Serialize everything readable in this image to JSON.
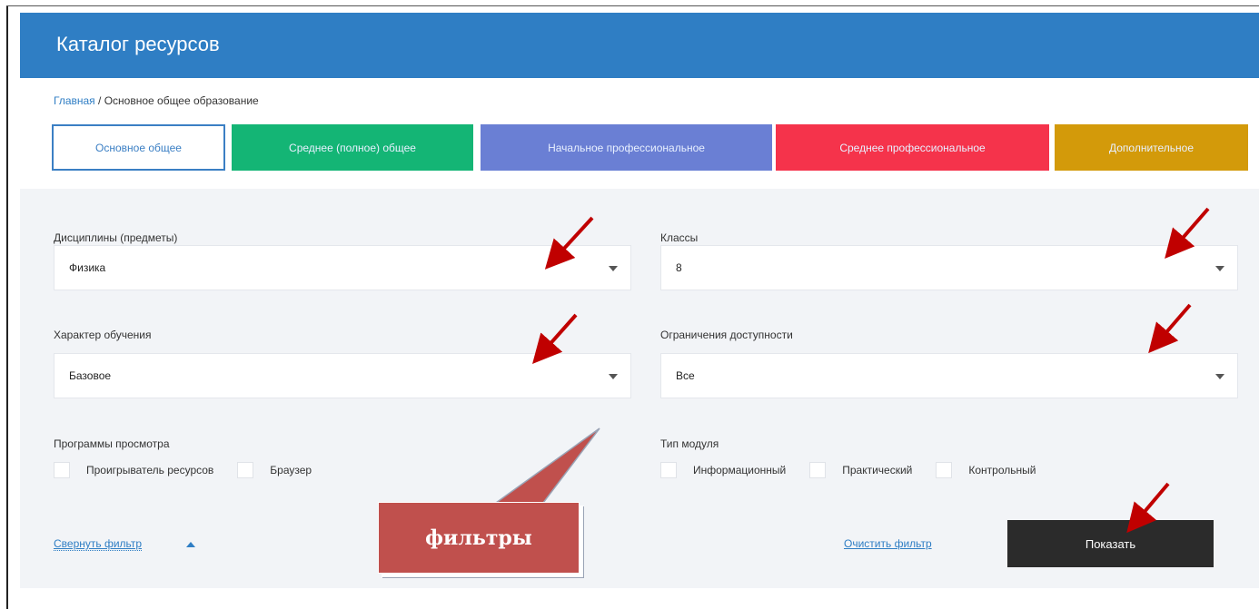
{
  "header": {
    "title": "Каталог ресурсов"
  },
  "breadcrumb": {
    "home": "Главная",
    "separator": " / ",
    "current": "Основное общее образование"
  },
  "levels": [
    {
      "label": "Основное общее",
      "active": true
    },
    {
      "label": "Среднее (полное) общее",
      "color": "#14b575"
    },
    {
      "label": "Начальное профессиональное",
      "color": "#6a7fd4"
    },
    {
      "label": "Среднее профессиональное",
      "color": "#f5334b"
    },
    {
      "label": "Дополнительное",
      "color": "#d39a0a"
    }
  ],
  "filters": {
    "disciplines": {
      "label": "Дисциплины (предметы)",
      "value": "Физика"
    },
    "grades": {
      "label": "Классы",
      "value": "8"
    },
    "learning": {
      "label": "Характер обучения",
      "value": "Базовое"
    },
    "access": {
      "label": "Ограничения доступности",
      "value": "Все"
    },
    "viewers": {
      "label": "Программы просмотра",
      "options": [
        "Проигрыватель ресурсов",
        "Браузер"
      ]
    },
    "module_type": {
      "label": "Тип модуля",
      "options": [
        "Информационный",
        "Практический",
        "Контрольный"
      ]
    }
  },
  "actions": {
    "collapse": "Свернуть фильтр",
    "clear": "Очистить фильтр",
    "show": "Показать"
  },
  "annotation": {
    "callout": "фильтры",
    "arrow_color": "#c00000"
  },
  "colors": {
    "header": "#2f7ec4",
    "panel": "#f2f4f7",
    "button": "#2b2b2b"
  }
}
